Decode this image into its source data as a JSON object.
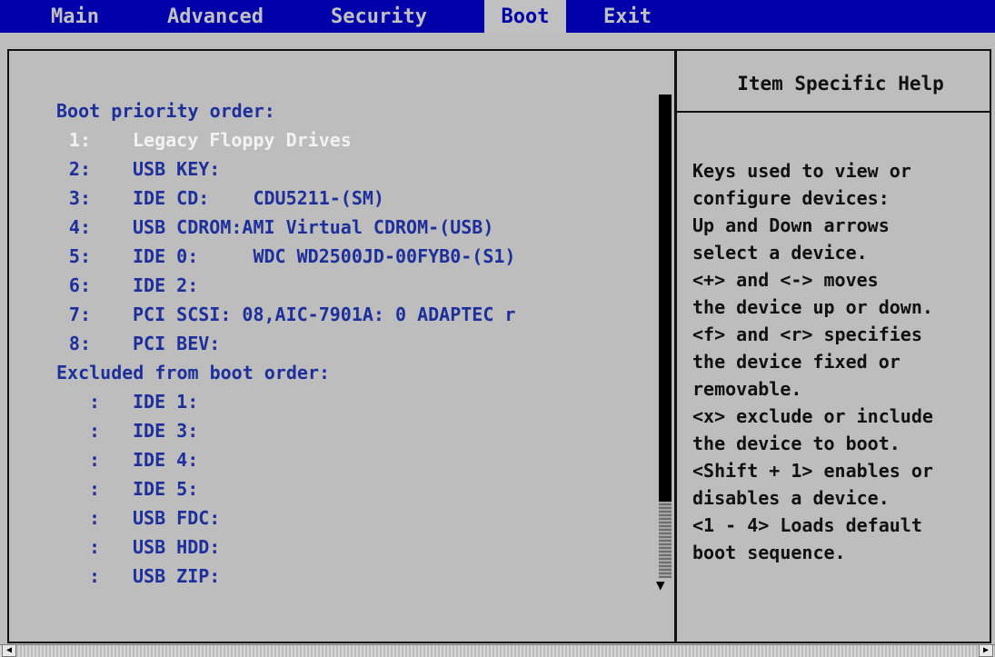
{
  "menu": {
    "tabs": [
      "Main",
      "Advanced",
      "Security",
      "Boot",
      "Exit"
    ],
    "active": "Boot"
  },
  "boot": {
    "priority_heading": "Boot priority order:",
    "priority": [
      {
        "num": "1:",
        "text": "Legacy Floppy Drives",
        "selected": true
      },
      {
        "num": "2:",
        "text": "USB KEY:"
      },
      {
        "num": "3:",
        "text": "IDE CD:    CDU5211-(SM)"
      },
      {
        "num": "4:",
        "text": "USB CDROM:AMI Virtual CDROM-(USB)"
      },
      {
        "num": "5:",
        "text": "IDE 0:     WDC WD2500JD-00FYB0-(S1)"
      },
      {
        "num": "6:",
        "text": "IDE 2:"
      },
      {
        "num": "7:",
        "text": "PCI SCSI: 08,AIC-7901A: 0 ADAPTEC r"
      },
      {
        "num": "8:",
        "text": "PCI BEV:"
      }
    ],
    "excluded_heading": "Excluded from boot order:",
    "excluded": [
      {
        "num": ":",
        "text": "IDE 1:"
      },
      {
        "num": ":",
        "text": "IDE 3:"
      },
      {
        "num": ":",
        "text": "IDE 4:"
      },
      {
        "num": ":",
        "text": "IDE 5:"
      },
      {
        "num": ":",
        "text": "USB FDC:"
      },
      {
        "num": ":",
        "text": "USB HDD:"
      },
      {
        "num": ":",
        "text": "USB ZIP:"
      }
    ]
  },
  "help": {
    "title": "Item Specific Help",
    "lines": [
      "Keys used to view or",
      "configure devices:",
      "Up and Down arrows",
      "select a device.",
      "<+> and <-> moves",
      "the device up or down.",
      "<f> and <r> specifies",
      "the device fixed or",
      "removable.",
      "<x> exclude or include",
      "the device to boot.",
      "<Shift + 1> enables or",
      "disables a device.",
      "<1 - 4> Loads default",
      "boot sequence."
    ]
  },
  "scrollbar": {
    "arrow_down_icon": "down-triangle",
    "arrow_glyph": "▼",
    "h_left_glyph": "◀",
    "h_right_glyph": "▶"
  }
}
